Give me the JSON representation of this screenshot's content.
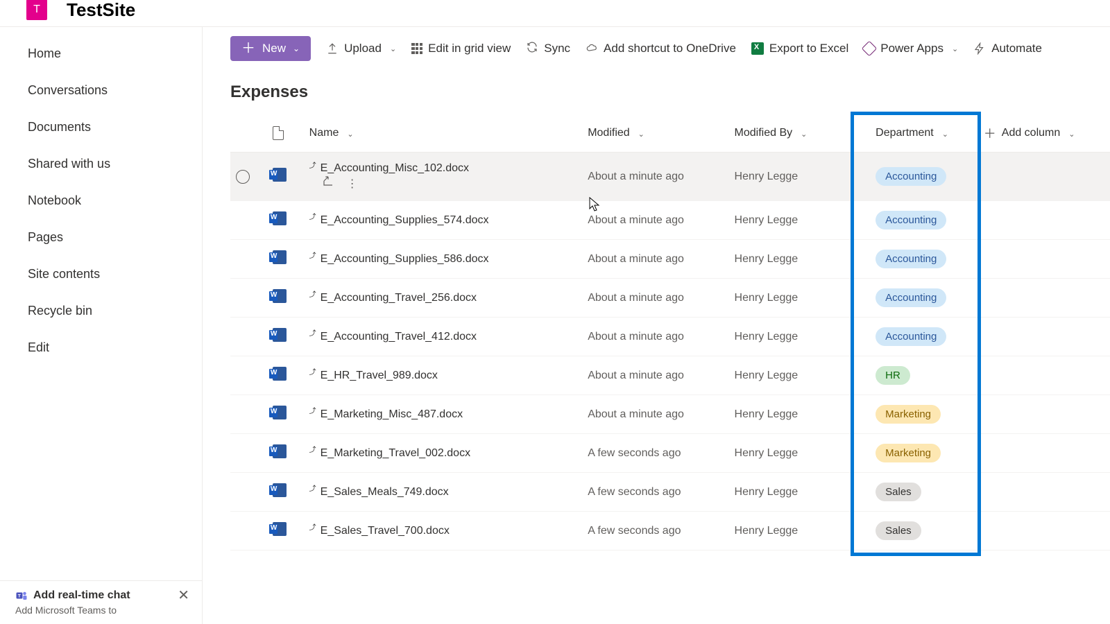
{
  "site": {
    "logo_letter": "T",
    "title": "TestSite"
  },
  "nav": {
    "items": [
      {
        "label": "Home"
      },
      {
        "label": "Conversations"
      },
      {
        "label": "Documents"
      },
      {
        "label": "Shared with us"
      },
      {
        "label": "Notebook"
      },
      {
        "label": "Pages"
      },
      {
        "label": "Site contents"
      },
      {
        "label": "Recycle bin"
      },
      {
        "label": "Edit"
      }
    ]
  },
  "promo": {
    "title": "Add real-time chat",
    "subtitle": "Add Microsoft Teams to"
  },
  "cmdbar": {
    "new_label": "New",
    "upload": "Upload",
    "edit_grid": "Edit in grid view",
    "sync": "Sync",
    "add_shortcut": "Add shortcut to OneDrive",
    "export": "Export to Excel",
    "power_apps": "Power Apps",
    "automate": "Automate"
  },
  "list": {
    "title": "Expenses",
    "columns": {
      "name": "Name",
      "modified": "Modified",
      "modified_by": "Modified By",
      "department": "Department",
      "add_column": "Add column"
    },
    "rows": [
      {
        "name": "E_Accounting_Misc_102.docx",
        "modified": "About a minute ago",
        "by": "Henry Legge",
        "dept": "Accounting",
        "hover": true
      },
      {
        "name": "E_Accounting_Supplies_574.docx",
        "modified": "About a minute ago",
        "by": "Henry Legge",
        "dept": "Accounting"
      },
      {
        "name": "E_Accounting_Supplies_586.docx",
        "modified": "About a minute ago",
        "by": "Henry Legge",
        "dept": "Accounting"
      },
      {
        "name": "E_Accounting_Travel_256.docx",
        "modified": "About a minute ago",
        "by": "Henry Legge",
        "dept": "Accounting"
      },
      {
        "name": "E_Accounting_Travel_412.docx",
        "modified": "About a minute ago",
        "by": "Henry Legge",
        "dept": "Accounting"
      },
      {
        "name": "E_HR_Travel_989.docx",
        "modified": "About a minute ago",
        "by": "Henry Legge",
        "dept": "HR"
      },
      {
        "name": "E_Marketing_Misc_487.docx",
        "modified": "About a minute ago",
        "by": "Henry Legge",
        "dept": "Marketing"
      },
      {
        "name": "E_Marketing_Travel_002.docx",
        "modified": "A few seconds ago",
        "by": "Henry Legge",
        "dept": "Marketing"
      },
      {
        "name": "E_Sales_Meals_749.docx",
        "modified": "A few seconds ago",
        "by": "Henry Legge",
        "dept": "Sales"
      },
      {
        "name": "E_Sales_Travel_700.docx",
        "modified": "A few seconds ago",
        "by": "Henry Legge",
        "dept": "Sales"
      }
    ]
  }
}
